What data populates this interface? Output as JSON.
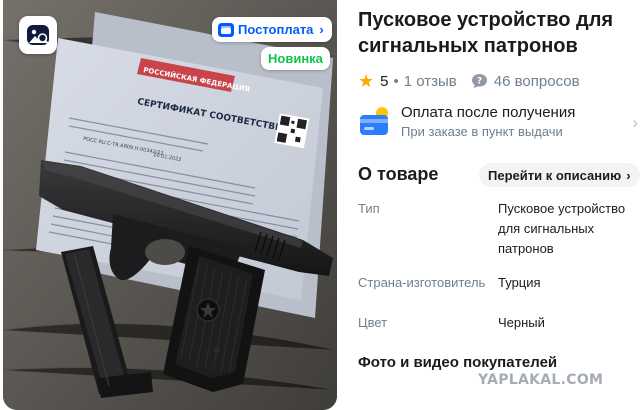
{
  "photo": {
    "badge_payment": "Постоплата",
    "badge_new": "Новинка",
    "certificate": {
      "header": "РОССИЙСКАЯ ФЕДЕРАЦИЯ",
      "title": "СЕРТИФИКАТ СООТВЕТСТВИЯ",
      "number": "РОСС RU.С-TR.АЯ09.Н.00342/22",
      "date": "20.01.2022"
    }
  },
  "product": {
    "title": "Пусковое устройство для сигнальных патронов",
    "rating": "5",
    "reviews": "1 отзыв",
    "questions": "46 вопросов"
  },
  "payment": {
    "title": "Оплата после получения",
    "subtitle": "При заказе в пункт выдачи"
  },
  "about": {
    "title": "О товаре",
    "link": "Перейти к описанию"
  },
  "specs": [
    {
      "key": "Тип",
      "value": "Пусковое устройство для сигнальных патронов"
    },
    {
      "key": "Страна-изготовитель",
      "value": "Турция"
    },
    {
      "key": "Цвет",
      "value": "Черный"
    }
  ],
  "media": {
    "title": "Фото и видео покупателей"
  },
  "watermark": "YAPLAKAL.COM",
  "colors": {
    "accent": "#005bff",
    "new_badge": "#10c44c",
    "star": "#ffa800",
    "muted": "#707f8d"
  },
  "icons": [
    "visual-search-icon",
    "postoplata-icon",
    "star-icon",
    "question-icon",
    "payment-card-icon",
    "chevron-right-icon"
  ]
}
